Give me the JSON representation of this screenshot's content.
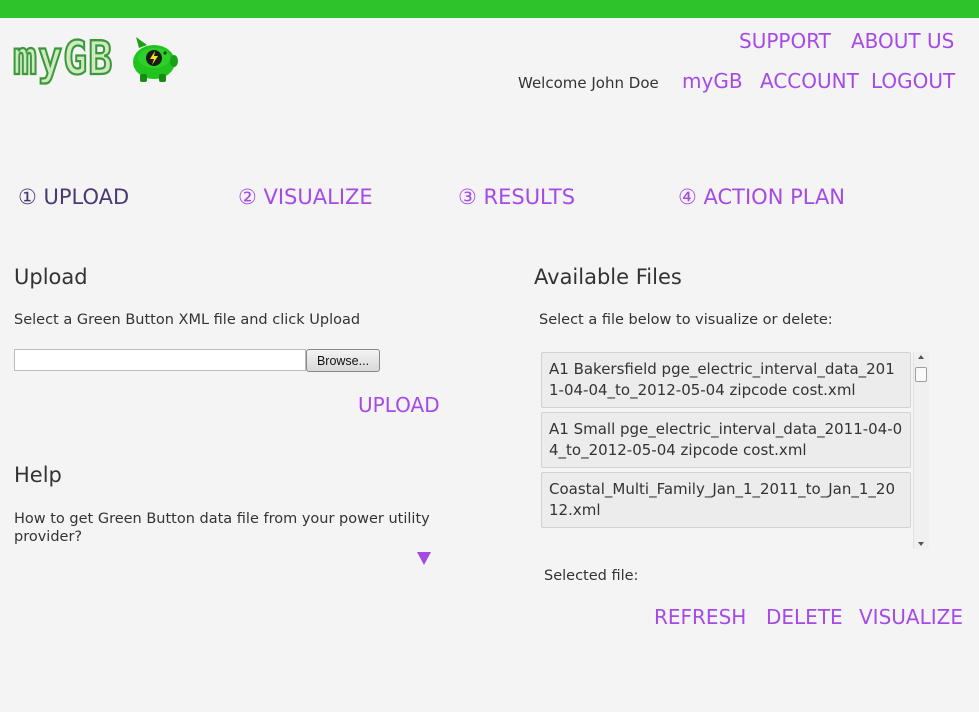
{
  "header": {
    "logo_text": "myGB",
    "welcome": "Welcome John Doe",
    "nav_top": [
      "SUPPORT",
      "ABOUT US"
    ],
    "nav_user": [
      "myGB",
      "ACCOUNT",
      "LOGOUT"
    ]
  },
  "steps": [
    {
      "label": "① UPLOAD"
    },
    {
      "label": "② VISUALIZE"
    },
    {
      "label": "③ RESULTS"
    },
    {
      "label": "④ ACTION PLAN"
    }
  ],
  "upload": {
    "title": "Upload",
    "instruction": "Select a Green Button XML file and click Upload",
    "file_value": "",
    "browse_label": "Browse...",
    "upload_label": "UPLOAD"
  },
  "help": {
    "title": "Help",
    "question": "How to get Green Button data file from your power utility provider?"
  },
  "files": {
    "title": "Available Files",
    "instruction": "Select a file below to visualize or delete:",
    "items": [
      "A1 Bakersfield pge_electric_interval_data_2011-04-04_to_2012-05-04 zipcode cost.xml",
      "A1 Small pge_electric_interval_data_2011-04-04_to_2012-05-04 zipcode cost.xml",
      "Coastal_Multi_Family_Jan_1_2011_to_Jan_1_2012.xml"
    ],
    "selected_label": "Selected file:",
    "actions": [
      "REFRESH",
      "DELETE",
      "VISUALIZE"
    ]
  },
  "colors": {
    "accent": "#a64ae6",
    "brand_green": "#2ec32a",
    "active_step": "#4b3a72"
  }
}
